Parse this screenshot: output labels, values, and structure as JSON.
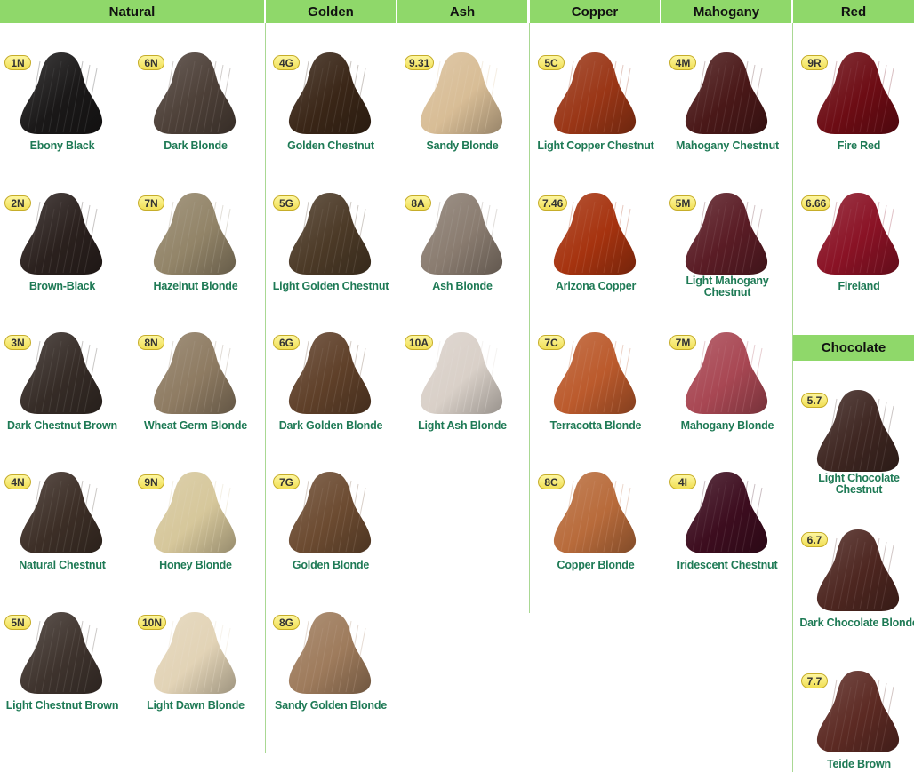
{
  "colors": {
    "header_bg": "#8fd86a",
    "divider": "#a9d893",
    "label": "#1e7a55",
    "badge": "#f5e56b"
  },
  "headers": {
    "natural": "Natural",
    "golden": "Golden",
    "ash": "Ash",
    "copper": "Copper",
    "mahogany": "Mahogany",
    "red": "Red",
    "chocolate": "Chocolate"
  },
  "swatches": [
    {
      "code": "1N",
      "name": "Ebony Black",
      "color": "#1a1818"
    },
    {
      "code": "6N",
      "name": "Dark Blonde",
      "color": "#4d4038"
    },
    {
      "code": "2N",
      "name": "Brown-Black",
      "color": "#2b211e"
    },
    {
      "code": "7N",
      "name": "Hazelnut Blonde",
      "color": "#928468"
    },
    {
      "code": "3N",
      "name": "Dark Chestnut Brown",
      "color": "#362c27"
    },
    {
      "code": "8N",
      "name": "Wheat Germ Blonde",
      "color": "#8e7b62"
    },
    {
      "code": "4N",
      "name": "Natural Chestnut",
      "color": "#3d2f27"
    },
    {
      "code": "9N",
      "name": "Honey Blonde",
      "color": "#d6c79b"
    },
    {
      "code": "5N",
      "name": "Light Chestnut Brown",
      "color": "#3f342e"
    },
    {
      "code": "10N",
      "name": "Light Dawn Blonde",
      "color": "#e2d3b6"
    },
    {
      "code": "4G",
      "name": "Golden Chestnut",
      "color": "#3a2617"
    },
    {
      "code": "5G",
      "name": "Light Golden Chestnut",
      "color": "#4c3a27"
    },
    {
      "code": "6G",
      "name": "Dark Golden Blonde",
      "color": "#5f4029"
    },
    {
      "code": "7G",
      "name": "Golden Blonde",
      "color": "#6c4b31"
    },
    {
      "code": "8G",
      "name": "Sandy Golden Blonde",
      "color": "#9e7b5c"
    },
    {
      "code": "9.31",
      "name": "Sandy Blonde",
      "color": "#d8bd96"
    },
    {
      "code": "8A",
      "name": "Ash Blonde",
      "color": "#8a7c70"
    },
    {
      "code": "10A",
      "name": "Light Ash Blonde",
      "color": "#d9d0c8"
    },
    {
      "code": "5C",
      "name": "Light Copper Chestnut",
      "color": "#9a3616"
    },
    {
      "code": "7.46",
      "name": "Arizona Copper",
      "color": "#a6330f"
    },
    {
      "code": "7C",
      "name": "Terracotta Blonde",
      "color": "#bb5a2c"
    },
    {
      "code": "8C",
      "name": "Copper Blonde",
      "color": "#b86b3b"
    },
    {
      "code": "4M",
      "name": "Mahogany Chestnut",
      "color": "#4a1818"
    },
    {
      "code": "5M",
      "name": "Light Mahogany Chestnut",
      "color": "#5a1c25"
    },
    {
      "code": "7M",
      "name": "Mahogany Blonde",
      "color": "#a84753"
    },
    {
      "code": "4I",
      "name": "Iridescent Chestnut",
      "color": "#3d0d1f"
    },
    {
      "code": "9R",
      "name": "Fire Red",
      "color": "#6d0c14"
    },
    {
      "code": "6.66",
      "name": "Fireland",
      "color": "#8a1225"
    },
    {
      "code": "5.7",
      "name": "Light Chocolate Chestnut",
      "color": "#3e2621"
    },
    {
      "code": "6.7",
      "name": "Dark Chocolate Blonde",
      "color": "#4d2620"
    },
    {
      "code": "7.7",
      "name": "Teide Brown",
      "color": "#5c2a23"
    }
  ]
}
